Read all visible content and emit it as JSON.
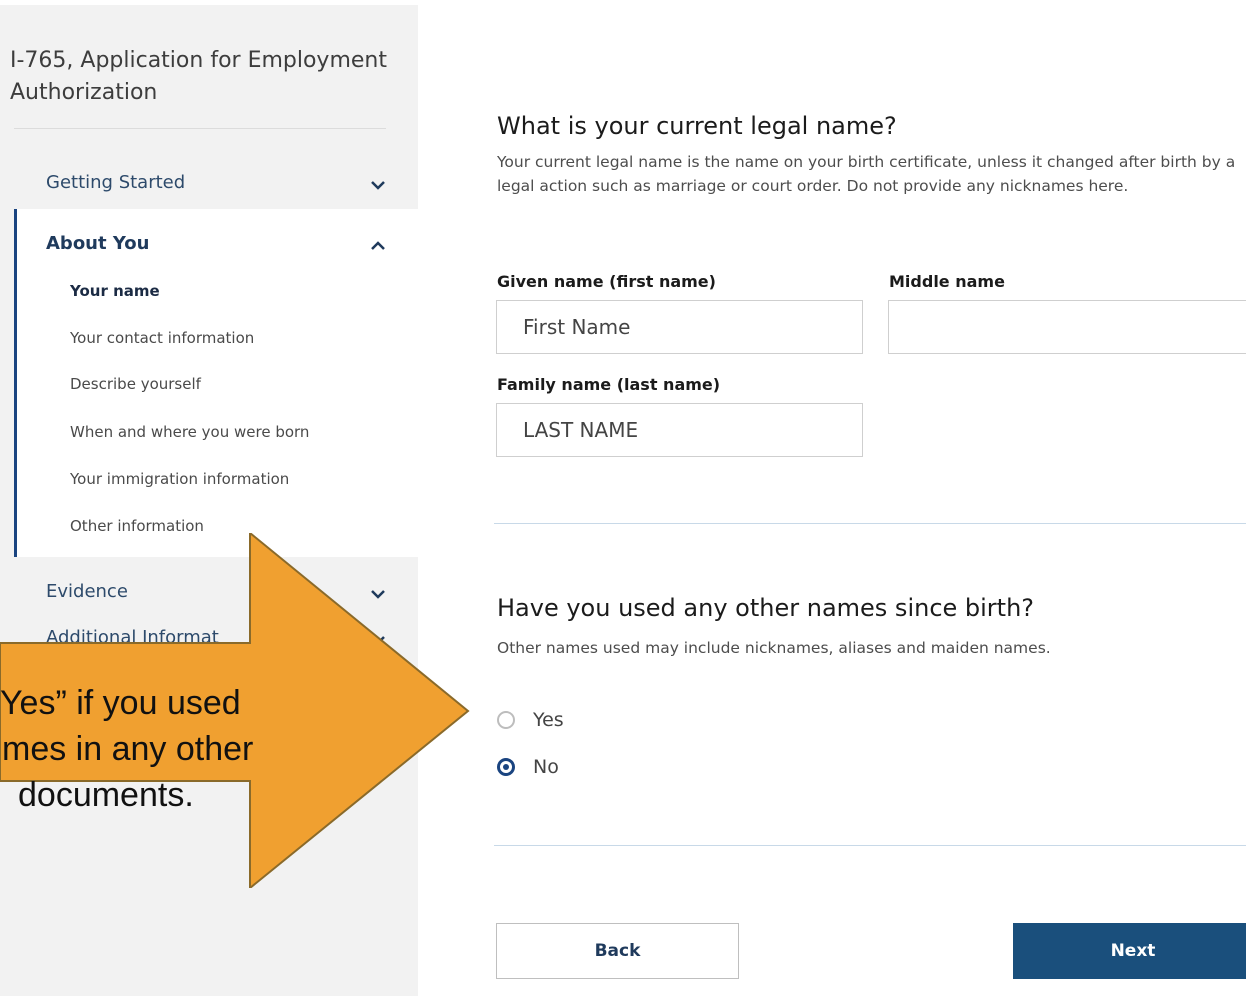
{
  "sidebar": {
    "form_title": "I-765, Application for Employment Authorization",
    "sections": [
      {
        "label": "Getting Started",
        "expanded": false
      },
      {
        "label": "About You",
        "expanded": true
      },
      {
        "label": "Evidence",
        "expanded": false
      },
      {
        "label": "Additional Informat",
        "expanded": false
      }
    ],
    "about_items": [
      {
        "label": "Your name",
        "active": true
      },
      {
        "label": "Your contact information",
        "active": false
      },
      {
        "label": "Describe yourself",
        "active": false
      },
      {
        "label": "When and where you were born",
        "active": false
      },
      {
        "label": "Your immigration information",
        "active": false
      },
      {
        "label": "Other information",
        "active": false
      }
    ]
  },
  "main": {
    "name_question": {
      "title": "What is your current legal name?",
      "help": "Your current legal name is the name on your birth certificate, unless it changed after birth by a legal action such as marriage or court order. Do not provide any nicknames here."
    },
    "fields": {
      "given_label": "Given name (first name)",
      "given_value": "First Name",
      "middle_label": "Middle name",
      "middle_value": "",
      "family_label": "Family name (last name)",
      "family_value": "LAST NAME"
    },
    "other_names_question": {
      "title": "Have you used any other names since birth?",
      "help": "Other names used may include nicknames, aliases and maiden names.",
      "options": [
        "Yes",
        "No"
      ],
      "selected": "No"
    },
    "buttons": {
      "back": "Back",
      "next": "Next"
    }
  },
  "callout": {
    "lines": [
      "Yes” if you used",
      "mes in any other",
      "documents."
    ],
    "color": "#f0a030"
  },
  "colors": {
    "primary": "#1a4480",
    "sidebar_bg": "#f2f2f2",
    "callout_fill": "#f0a030"
  }
}
